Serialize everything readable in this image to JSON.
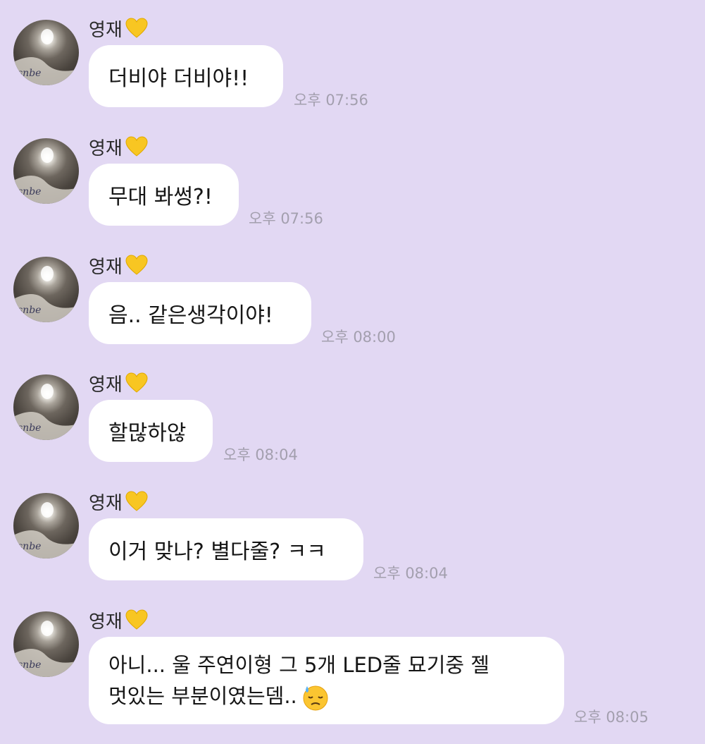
{
  "sender": {
    "name": "영재",
    "heart_icon": "yellow-heart-icon",
    "heart_color": "#f8c622"
  },
  "colors": {
    "background": "#e2d8f3",
    "bubble": "#ffffff",
    "time": "#a39fae"
  },
  "messages": [
    {
      "text": "더비야 더비야!!",
      "time": "오후 07:56"
    },
    {
      "text": "무대 봐썽?!",
      "time": "오후 07:56"
    },
    {
      "text": "음.. 같은생각이야!",
      "time": "오후 08:00"
    },
    {
      "text": "할많하않",
      "time": "오후 08:04"
    },
    {
      "text": "이거 맞나? 별다줄? ㅋㅋ",
      "time": "오후 08:04"
    },
    {
      "line1": "아니... 울 주연이형 그 5개 LED줄 묘기중 젤",
      "line2": "멋있는 부분이였는뎀..",
      "emoji": "downcast-sweat-face-icon",
      "time": "오후 08:05"
    }
  ]
}
